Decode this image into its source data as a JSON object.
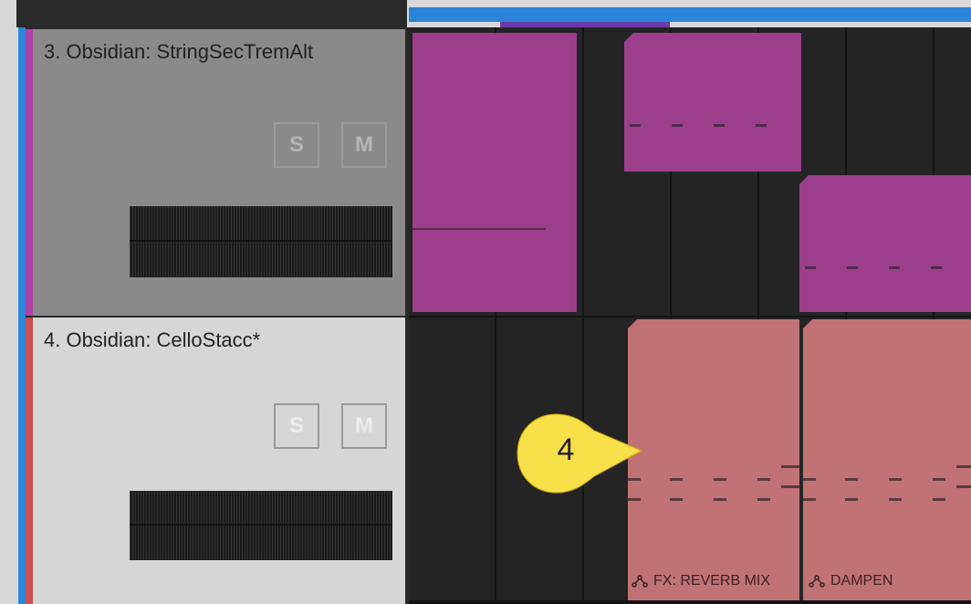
{
  "tracks": [
    {
      "name": "3. Obsidian: StringSecTremAlt",
      "color": "#b040a8",
      "solo_label": "S",
      "mute_label": "M",
      "clips": [
        {
          "kind": "purple"
        },
        {
          "kind": "purple"
        },
        {
          "kind": "purple"
        }
      ]
    },
    {
      "name": "4. Obsidian: CelloStacc*",
      "color": "#c85050",
      "solo_label": "S",
      "mute_label": "M",
      "clips": [
        {
          "kind": "pink",
          "automation_label": "FX: REVERB MIX"
        },
        {
          "kind": "pink",
          "automation_label": "DAMPEN"
        }
      ]
    }
  ],
  "callout": {
    "number": "4",
    "color": "#f7e04a"
  },
  "icons": {
    "automation": "automation-curve-icon"
  }
}
